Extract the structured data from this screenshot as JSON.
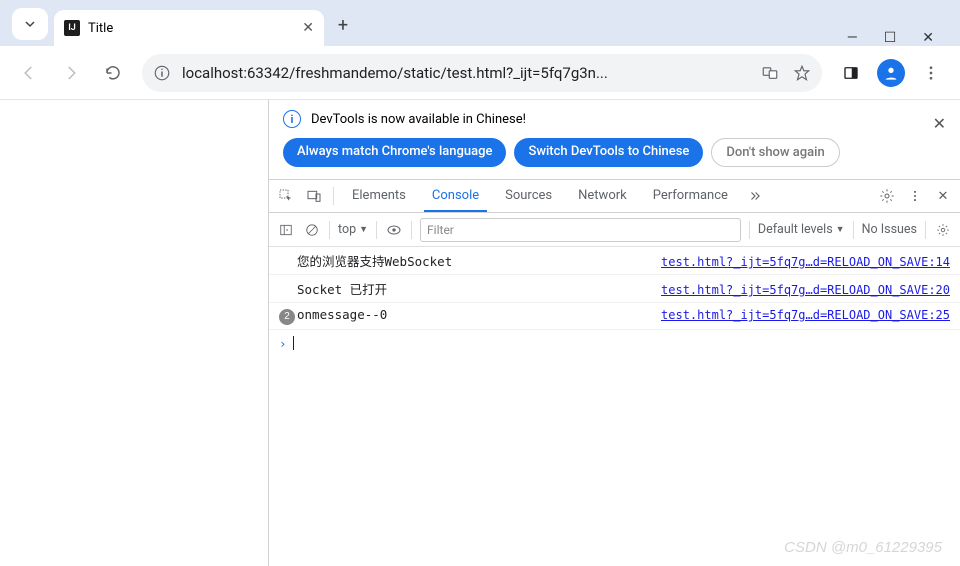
{
  "browser": {
    "tab_title": "Title",
    "url_display": "localhost:63342/freshmandemo/static/test.html?_ijt=5fq7g3n..."
  },
  "banner": {
    "message": "DevTools is now available in Chinese!",
    "pill1": "Always match Chrome's language",
    "pill2": "Switch DevTools to Chinese",
    "pill3": "Don't show again"
  },
  "devtools": {
    "tabs": {
      "elements": "Elements",
      "console": "Console",
      "sources": "Sources",
      "network": "Network",
      "performance": "Performance"
    },
    "console_toolbar": {
      "context": "top",
      "filter_placeholder": "Filter",
      "levels": "Default levels",
      "issues": "No Issues"
    },
    "messages": [
      {
        "badge": "",
        "text": "您的浏览器支持WebSocket",
        "link": "test.html?_ijt=5fq7g…d=RELOAD_ON_SAVE:14"
      },
      {
        "badge": "",
        "text": "Socket 已打开",
        "link": "test.html?_ijt=5fq7g…d=RELOAD_ON_SAVE:20"
      },
      {
        "badge": "2",
        "text": "onmessage--0",
        "link": "test.html?_ijt=5fq7g…d=RELOAD_ON_SAVE:25"
      }
    ]
  },
  "watermark": "CSDN @m0_61229395"
}
